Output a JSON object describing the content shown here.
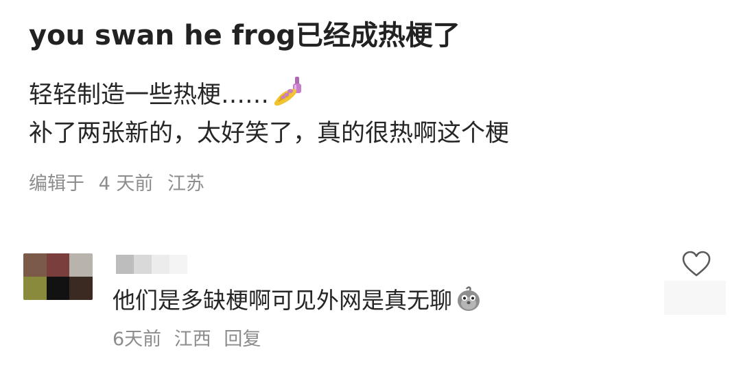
{
  "post": {
    "title": "you swan he frog已经成热梗了",
    "line1": "轻轻制造一些热梗……",
    "line1_emoji": "nail-polish-emoji",
    "line2": "补了两张新的，太好笑了，真的很热啊这个梗",
    "meta": {
      "edited": "编辑于",
      "time": "4 天前",
      "location": "江苏"
    }
  },
  "comment": {
    "avatar_colors": [
      "#7b5a4a",
      "#7a3e3c",
      "#b9b3ad",
      "#8a8a3d",
      "#121212",
      "#3a2a22"
    ],
    "name_colors": [
      "#bdbdbd",
      "#d9d9d9",
      "#ececec",
      "#f4f4f4"
    ],
    "text": "他们是多缺梗啊可见外网是真无聊",
    "text_emoji": "grey-bird-emoji",
    "meta": {
      "time": "6天前",
      "location": "江西",
      "reply": "回复"
    },
    "like_icon": "heart-outline-icon"
  }
}
